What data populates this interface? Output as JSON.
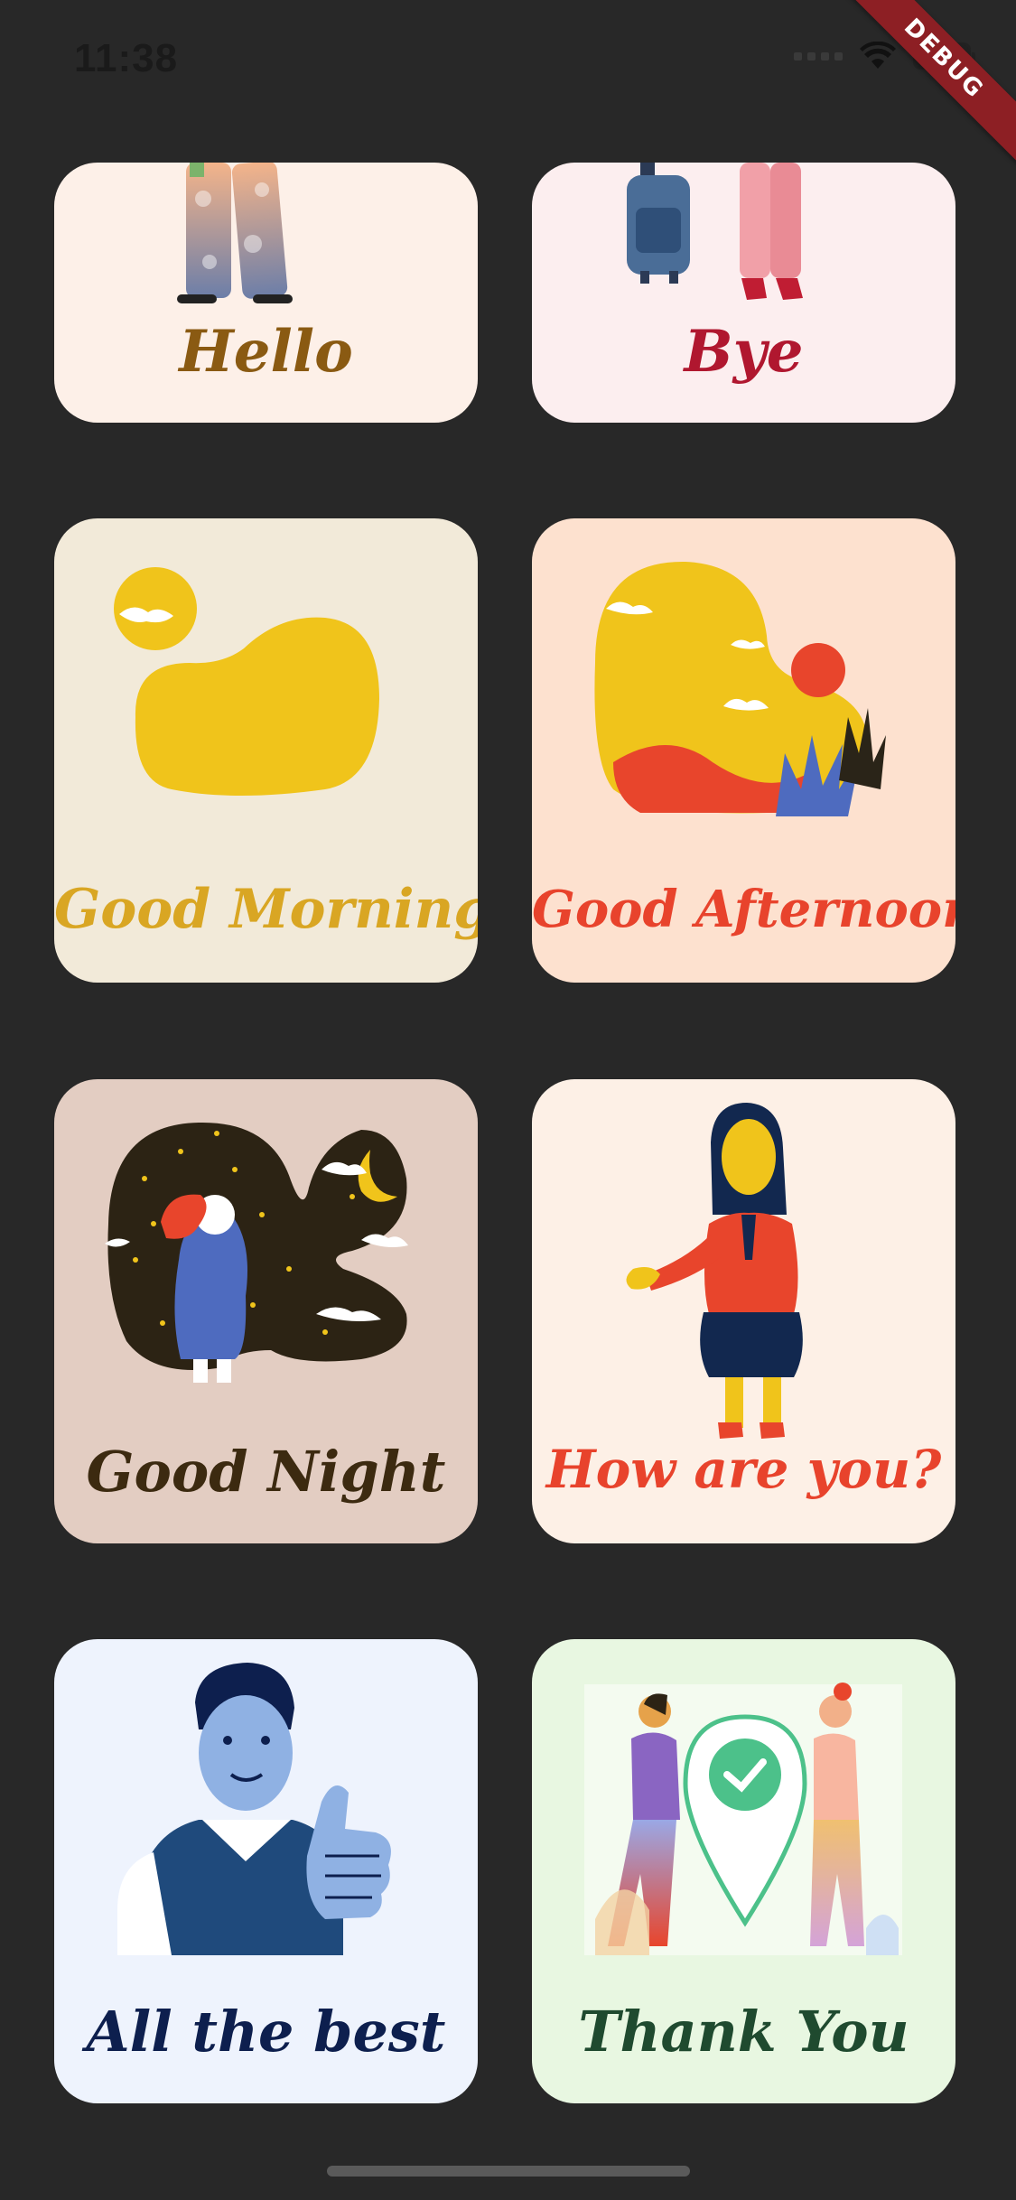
{
  "status_bar": {
    "time": "11:38"
  },
  "debug_banner": {
    "label": "DEBUG"
  },
  "cards": [
    {
      "label": "Hello",
      "bg": "#fdf0e8",
      "text_color": "#8a5a12",
      "illustration": "walking-person-icon"
    },
    {
      "label": "Bye",
      "bg": "#fceeef",
      "text_color": "#b0172f",
      "illustration": "person-with-backpack-icon"
    },
    {
      "label": "Good Morning",
      "bg": "#f2ead9",
      "text_color": "#d9a623",
      "illustration": "morning-sun-cloud-icon"
    },
    {
      "label": "Good Afternoon",
      "bg": "#fde1cf",
      "text_color": "#e8432c",
      "illustration": "afternoon-landscape-icon"
    },
    {
      "label": "Good Night",
      "bg": "#e3cdc2",
      "text_color": "#3c2a10",
      "illustration": "night-sky-girl-icon"
    },
    {
      "label": "How are you?",
      "bg": "#fdf0e6",
      "text_color": "#e8432c",
      "illustration": "businesswoman-handshake-icon"
    },
    {
      "label": "All the best",
      "bg": "#eef3fd",
      "text_color": "#0d1f4e",
      "illustration": "thumbs-up-man-icon"
    },
    {
      "label": "Thank You",
      "bg": "#e8f7e1",
      "text_color": "#1f4a2f",
      "illustration": "location-check-people-icon"
    }
  ]
}
